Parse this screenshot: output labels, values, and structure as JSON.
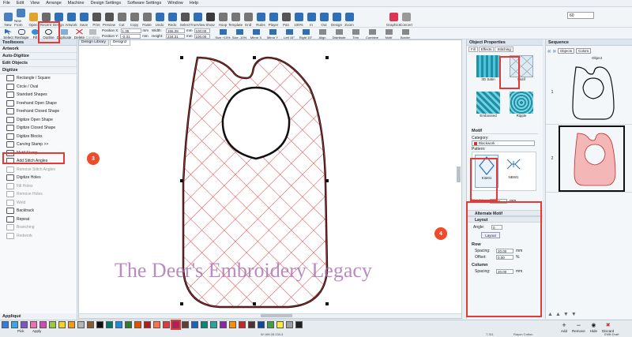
{
  "menu": [
    "File",
    "Edit",
    "View",
    "Arrange",
    "Machine",
    "Design Settings",
    "Software Settings",
    "Window",
    "Help"
  ],
  "toolbar": {
    "row1": [
      "New",
      "New From",
      "Open",
      "Recent",
      "Design",
      "Artwork",
      "Save",
      "Print",
      "Preview",
      "Cut",
      "Copy",
      "Paste",
      "Undo",
      "Redo",
      "Select",
      "TrueView",
      "Show",
      "Hoop",
      "Template",
      "Grid",
      "Rules",
      "Player",
      "Pan",
      "100%",
      "In",
      "Out",
      "Design",
      "Zoom",
      "Graphics",
      "Concert"
    ],
    "zoom_value": "60",
    "row2": [
      "Select",
      "Reshape",
      "Fill",
      "Outline",
      "Duplicate",
      "Delete",
      "Combine"
    ],
    "position_x_label": "Position X:",
    "position_x": "1.35",
    "position_x_unit": "mm",
    "position_y_label": "Position Y:",
    "position_y": "-0.31",
    "position_y_unit": "mm",
    "width_label": "Width:",
    "width": "166.28",
    "width_unit": "mm",
    "width_pct": "100.00",
    "height_label": "Height:",
    "height": "234.31",
    "height_unit": "mm",
    "height_pct": "100.00",
    "transform": [
      "Size +10%",
      "Size -10%",
      "Mirror X",
      "Mirror Y",
      "Left 15°",
      "Right 15°",
      "Align",
      "Distribute",
      "Trim",
      "Combine",
      "Motif",
      "Border"
    ]
  },
  "sidebar": {
    "title": "Toolboxes",
    "sections": [
      {
        "label": "Artwork"
      },
      {
        "label": "Auto-Digitize"
      },
      {
        "label": "Edit Objects"
      },
      {
        "label": "Digitize"
      }
    ],
    "items": [
      "Rectangle / Square",
      "Circle / Oval",
      "Standard Shapes",
      "Freehand Open Shape",
      "Freehand Closed Shape",
      "Digitize Open Shape",
      "Digitize Closed Shape",
      "Digitize Blocks",
      "Carving Stamp >>",
      "Motif Stamp...",
      "Add Stitch Angles",
      "Remove Stitch Angles",
      "Digitize Holes",
      "Fill Holes",
      "Remove Holes",
      "Weld",
      "Backtrack",
      "Repeat",
      "Branching",
      "Redwork"
    ],
    "footer": "Appliqué"
  },
  "canvas": {
    "tabs": [
      "Design Library",
      "Design2"
    ],
    "watermark": "The Deer's Embroidery Legacy"
  },
  "properties": {
    "title": "Object Properties",
    "tabs": [
      "Fill",
      "Effects",
      "Stitching"
    ],
    "fill_types": [
      "3D Satin",
      "Motif",
      "Embossed",
      "Ripple"
    ],
    "motif_title": "Motif",
    "category_label": "Category:",
    "category": "Blackwork",
    "pattern_label": "Pattern:",
    "patterns": [
      "Kite01",
      "NBW1"
    ],
    "height_label": "Height:",
    "height": "20.00",
    "height_unit": "mm",
    "alt_motif": "Alternate Motif",
    "layout": "Layout",
    "angle_label": "Angle:",
    "angle": "0",
    "layout_button": "Layout",
    "row_title": "Row",
    "spacing_label": "Spacing:",
    "row_spacing": "20.00",
    "row_spacing_unit": "mm",
    "offset_label": "Offset:",
    "row_offset": "0.00",
    "row_offset_unit": "%",
    "column_title": "Column",
    "col_spacing_label": "Spacing:",
    "col_spacing": "20.00",
    "col_spacing_unit": "mm"
  },
  "sequence": {
    "title": "Sequence",
    "tabs": [
      "Objects",
      "Colors"
    ],
    "col": "Object",
    "rows": [
      "1",
      "2"
    ]
  },
  "statusbar": {
    "pick": "Pick",
    "apply": "Apply",
    "coords": "W 166.28 234.3",
    "stitches": "7,311",
    "fabric": "Rayon Cotton",
    "mode": "EMB Draft"
  },
  "actions": [
    "Add",
    "Remove",
    "Hide",
    "Discard"
  ],
  "swatches": [
    "#2f7de1",
    "#3aa8e6",
    "#7e57c2",
    "#ef6fb0",
    "#d24ab0",
    "#9aca3c",
    "#f4d31e",
    "#f39c12",
    "#b5b5b5",
    "#8b5a2b",
    "#111111",
    "#00796b",
    "#1e88e5",
    "#2e7d32",
    "#e65100",
    "#b71c1c",
    "#ff7043",
    "#e53935",
    "#c2185b",
    "#5d4037",
    "#1565c0",
    "#00897b",
    "#26a69a",
    "#8e24aa",
    "#ff8f00",
    "#c62828",
    "#4e342e",
    "#0d47a1",
    "#43a047",
    "#ffeb3b",
    "#9e9e9e",
    "#212121"
  ],
  "annotations": [
    "3",
    "4"
  ]
}
